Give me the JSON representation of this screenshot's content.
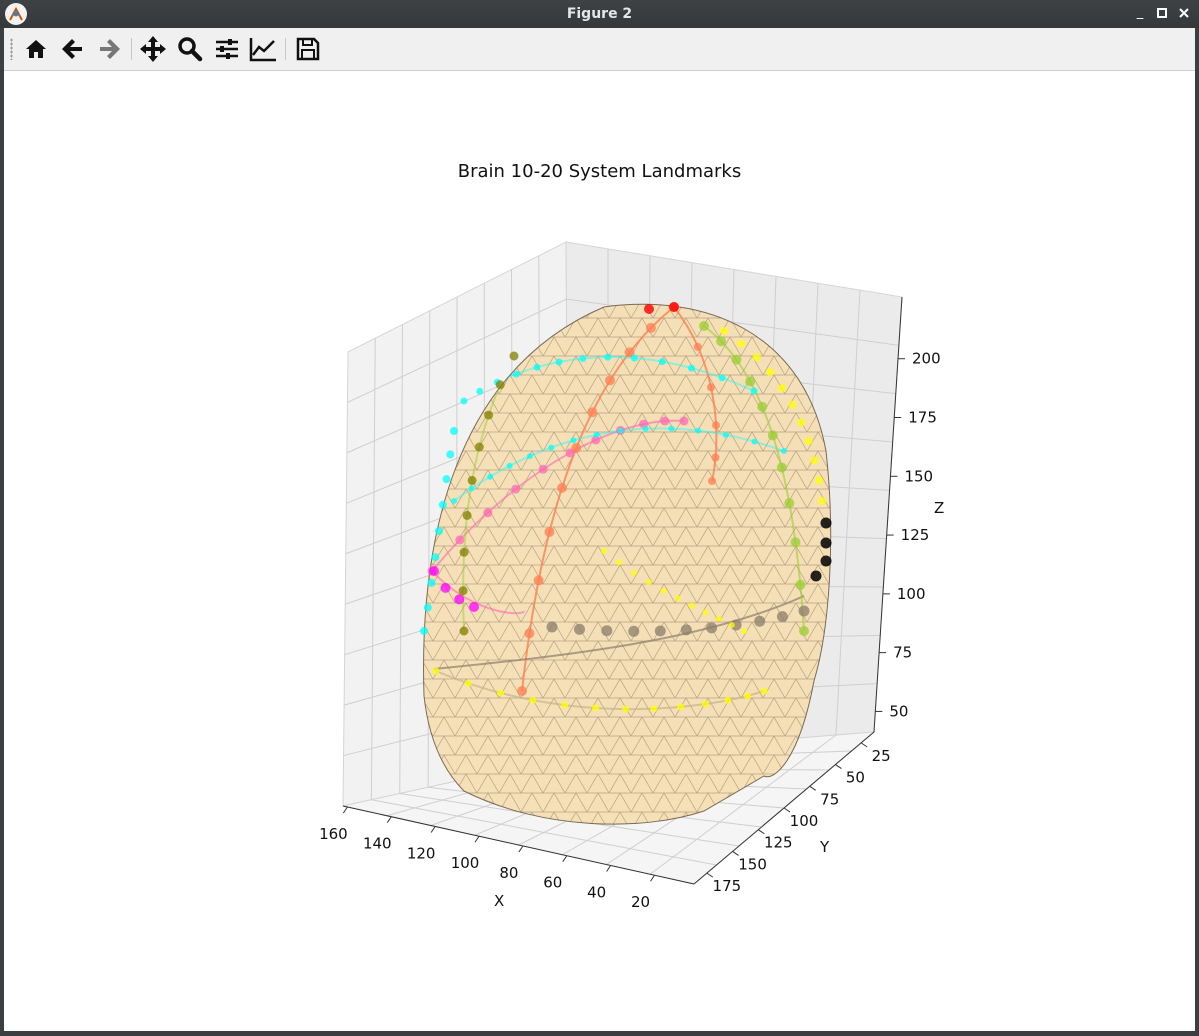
{
  "window": {
    "title": "Figure 2"
  },
  "toolbar": {
    "buttons": [
      {
        "name": "home-icon"
      },
      {
        "name": "back-arrow-icon"
      },
      {
        "name": "forward-arrow-icon"
      },
      {
        "name": "pan-icon"
      },
      {
        "name": "zoom-icon"
      },
      {
        "name": "configure-subplots-icon"
      },
      {
        "name": "edit-axis-icon"
      },
      {
        "name": "save-icon"
      }
    ]
  },
  "chart_data": {
    "type": "scatter",
    "title": "Brain 10-20 System Landmarks",
    "xlabel": "X",
    "ylabel": "Y",
    "zlabel": "Z",
    "x_ticks": [
      "160",
      "140",
      "120",
      "100",
      "80",
      "60",
      "40",
      "20"
    ],
    "y_ticks": [
      "25",
      "50",
      "75",
      "100",
      "125",
      "150",
      "175"
    ],
    "z_ticks": [
      "50",
      "75",
      "100",
      "125",
      "150",
      "175",
      "200"
    ],
    "grid": true,
    "colors": {
      "mesh_fill": "#f5deb3",
      "mesh_edge": "#555555",
      "markers": [
        "#00ffff",
        "#ff0000",
        "#ffff00",
        "#ff00ff",
        "#808000",
        "#ff7f50",
        "#8b7d6b",
        "#000000",
        "#ff69b4",
        "#9acd32"
      ]
    }
  }
}
